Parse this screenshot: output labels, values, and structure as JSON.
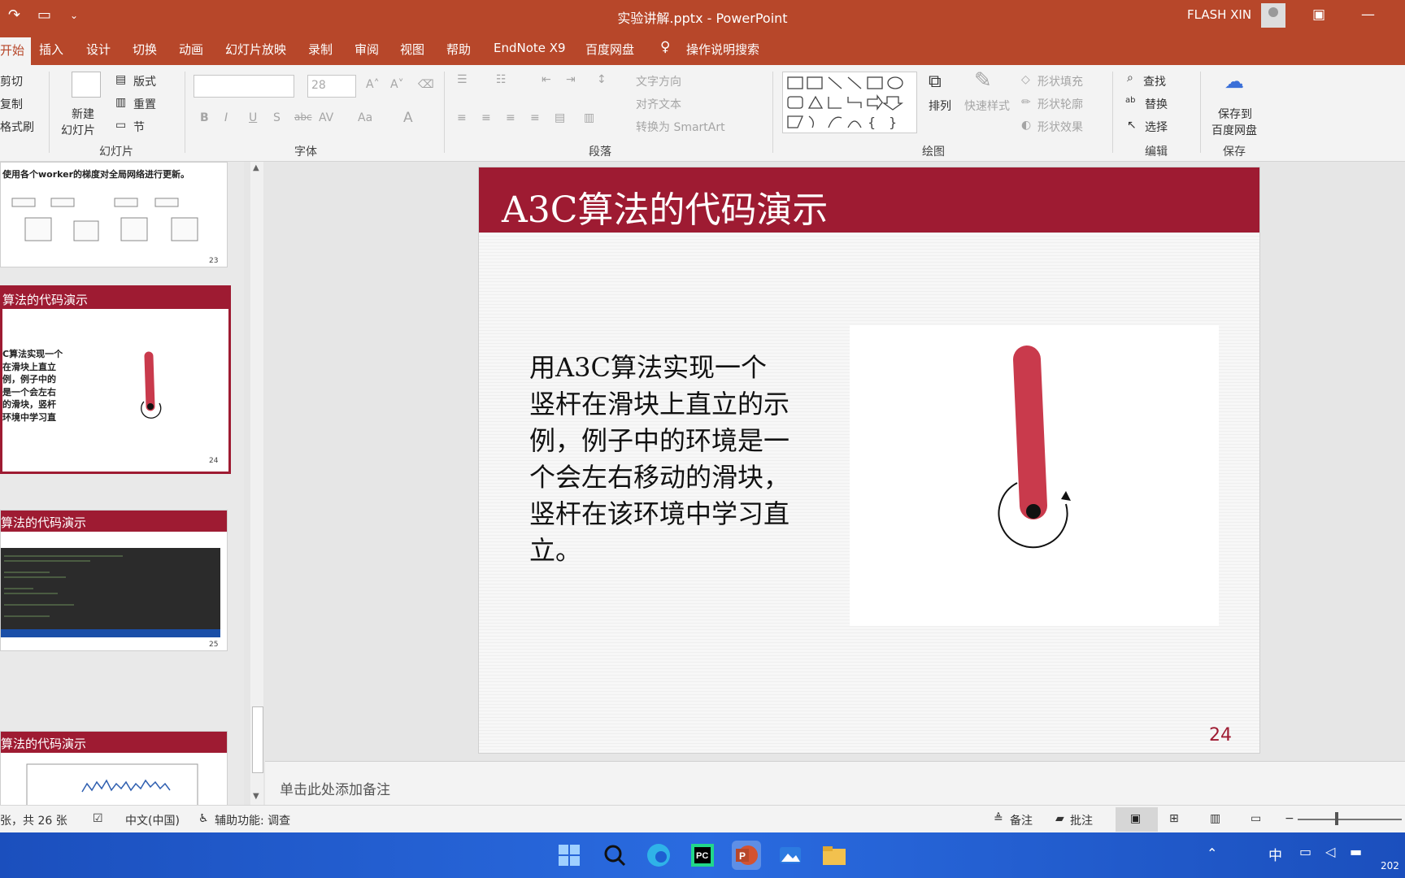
{
  "window": {
    "title": "实验讲解.pptx - PowerPoint",
    "user": "FLASH XIN"
  },
  "tabs": [
    "开始",
    "插入",
    "设计",
    "切换",
    "动画",
    "幻灯片放映",
    "录制",
    "审阅",
    "视图",
    "帮助",
    "EndNote X9",
    "百度网盘",
    "操作说明搜索"
  ],
  "ribbon": {
    "clipboard": {
      "cut": "剪切",
      "copy": "复制",
      "painter": "格式刷"
    },
    "slides": {
      "new_slide_line1": "新建",
      "new_slide_line2": "幻灯片",
      "layout": "版式",
      "reset": "重置",
      "section": "节",
      "group": "幻灯片"
    },
    "font": {
      "size": "28",
      "group": "字体"
    },
    "paragraph": {
      "text_direction": "文字方向",
      "align_text": "对齐文本",
      "smartart": "转换为 SmartArt",
      "group": "段落"
    },
    "drawing": {
      "arrange": "排列",
      "quick_styles": "快速样式",
      "shape_fill": "形状填充",
      "shape_outline": "形状轮廓",
      "shape_effects": "形状效果",
      "group": "绘图"
    },
    "editing": {
      "find": "查找",
      "replace": "替换",
      "select": "选择",
      "group": "编辑"
    },
    "save": {
      "line1": "保存到",
      "line2": "百度网盘",
      "group": "保存"
    }
  },
  "thumbnails": {
    "slide23": {
      "caption": "使用各个worker的梯度对全局网络进行更新。",
      "num": "23"
    },
    "slide24": {
      "title": "算法的代码演示",
      "text": "C算法实现一个\n在滑块上直立\n例，例子中的\n是一个会左右\n的滑块，竖杆\n环境中学习直",
      "num": "24"
    },
    "slide25": {
      "title": "算法的代码演示",
      "num": "25"
    },
    "slide26": {
      "title": "算法的代码演示"
    }
  },
  "slide": {
    "title": "A3C算法的代码演示",
    "body": "用A3C算法实现一个竖杆在滑块上直立的示例，例子中的环境是一个会左右移动的滑块，竖杆在该环境中学习直立。",
    "number": "24"
  },
  "notes": {
    "placeholder": "单击此处添加备注"
  },
  "status": {
    "slide_count": "张，共 26 张",
    "language": "中文(中国)",
    "accessibility": "辅助功能: 调查",
    "notes_btn": "备注",
    "comments_btn": "批注"
  },
  "taskbar": {
    "ime": "中",
    "year": "202"
  }
}
